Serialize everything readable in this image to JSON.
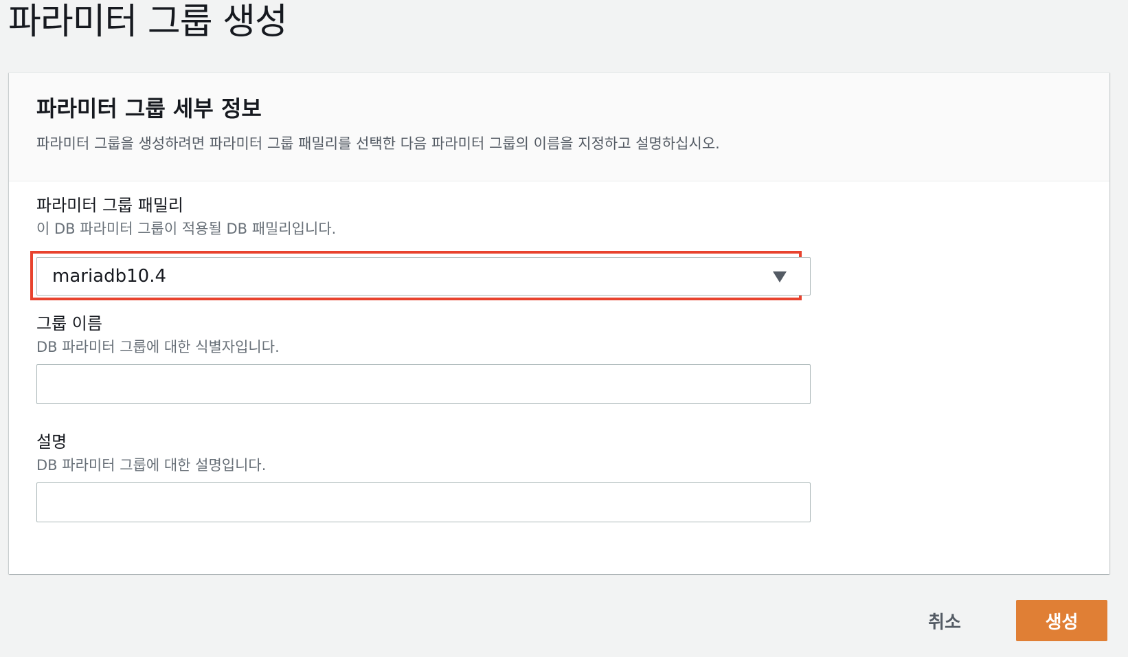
{
  "page": {
    "title": "파라미터 그룹 생성"
  },
  "panel": {
    "title": "파라미터 그룹 세부 정보",
    "description": "파라미터 그룹을 생성하려면 파라미터 그룹 패밀리를 선택한 다음 파라미터 그룹의 이름을 지정하고 설명하십시오."
  },
  "family": {
    "label": "파라미터 그룹 패밀리",
    "description": "이 DB 파라미터 그룹이 적용될 DB 패밀리입니다.",
    "selected_value": "mariadb10.4",
    "highlight_color": "#e8432e"
  },
  "group_name": {
    "label": "그룹 이름",
    "description": "DB 파라미터 그룹에 대한 식별자입니다.",
    "value": ""
  },
  "description_field": {
    "label": "설명",
    "description": "DB 파라미터 그룹에 대한 설명입니다.",
    "value": ""
  },
  "actions": {
    "cancel_label": "취소",
    "create_label": "생성",
    "primary_color": "#e07f35"
  }
}
